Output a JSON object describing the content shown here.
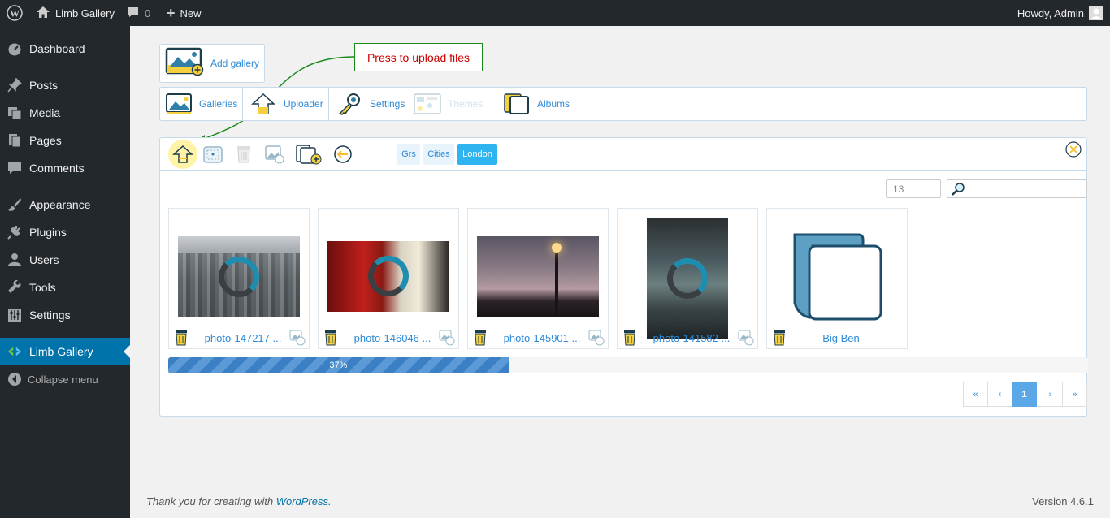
{
  "adminbar": {
    "site_name": "Limb Gallery",
    "comments_count": "0",
    "new_label": "New",
    "howdy": "Howdy, Admin"
  },
  "sidebar": {
    "items": [
      {
        "label": "Dashboard",
        "icon": "dashboard-icon"
      },
      {
        "label": "Posts",
        "icon": "pin-icon"
      },
      {
        "label": "Media",
        "icon": "media-icon"
      },
      {
        "label": "Pages",
        "icon": "pages-icon"
      },
      {
        "label": "Comments",
        "icon": "comment-icon"
      },
      {
        "label": "Appearance",
        "icon": "brush-icon"
      },
      {
        "label": "Plugins",
        "icon": "plug-icon"
      },
      {
        "label": "Users",
        "icon": "user-icon"
      },
      {
        "label": "Tools",
        "icon": "wrench-icon"
      },
      {
        "label": "Settings",
        "icon": "settings-icon"
      },
      {
        "label": "Limb Gallery",
        "icon": "limb-icon"
      }
    ],
    "collapse": "Collapse menu"
  },
  "gallery": {
    "add_gallery": "Add gallery",
    "callout": "Press to upload files",
    "tabs": [
      {
        "label": "Galleries"
      },
      {
        "label": "Uploader"
      },
      {
        "label": "Settings"
      },
      {
        "label": "Themes"
      },
      {
        "label": "Albums"
      }
    ],
    "breadcrumbs": [
      "Grs",
      "Cities",
      "London"
    ],
    "per_page": "13",
    "search_placeholder": "",
    "items": [
      {
        "caption": "photo-147217 ..."
      },
      {
        "caption": "photo-146046 ..."
      },
      {
        "caption": "photo-145901 ..."
      },
      {
        "caption": "photo-141582 ..."
      },
      {
        "caption": "Big Ben"
      }
    ],
    "progress": {
      "value": 0.37,
      "label": "37%"
    },
    "pagination": [
      "«",
      "‹",
      "1",
      "›",
      "»"
    ]
  },
  "footer": {
    "thanks": "Thank you for creating with ",
    "wp_link": "WordPress.",
    "version": "Version 4.6.1"
  },
  "colors": {
    "accent": "#0073aa",
    "link": "#2e8ad8",
    "callout_border": "#1a8a1a",
    "callout_text": "#cc0000",
    "progress": "#3b7fc4"
  }
}
